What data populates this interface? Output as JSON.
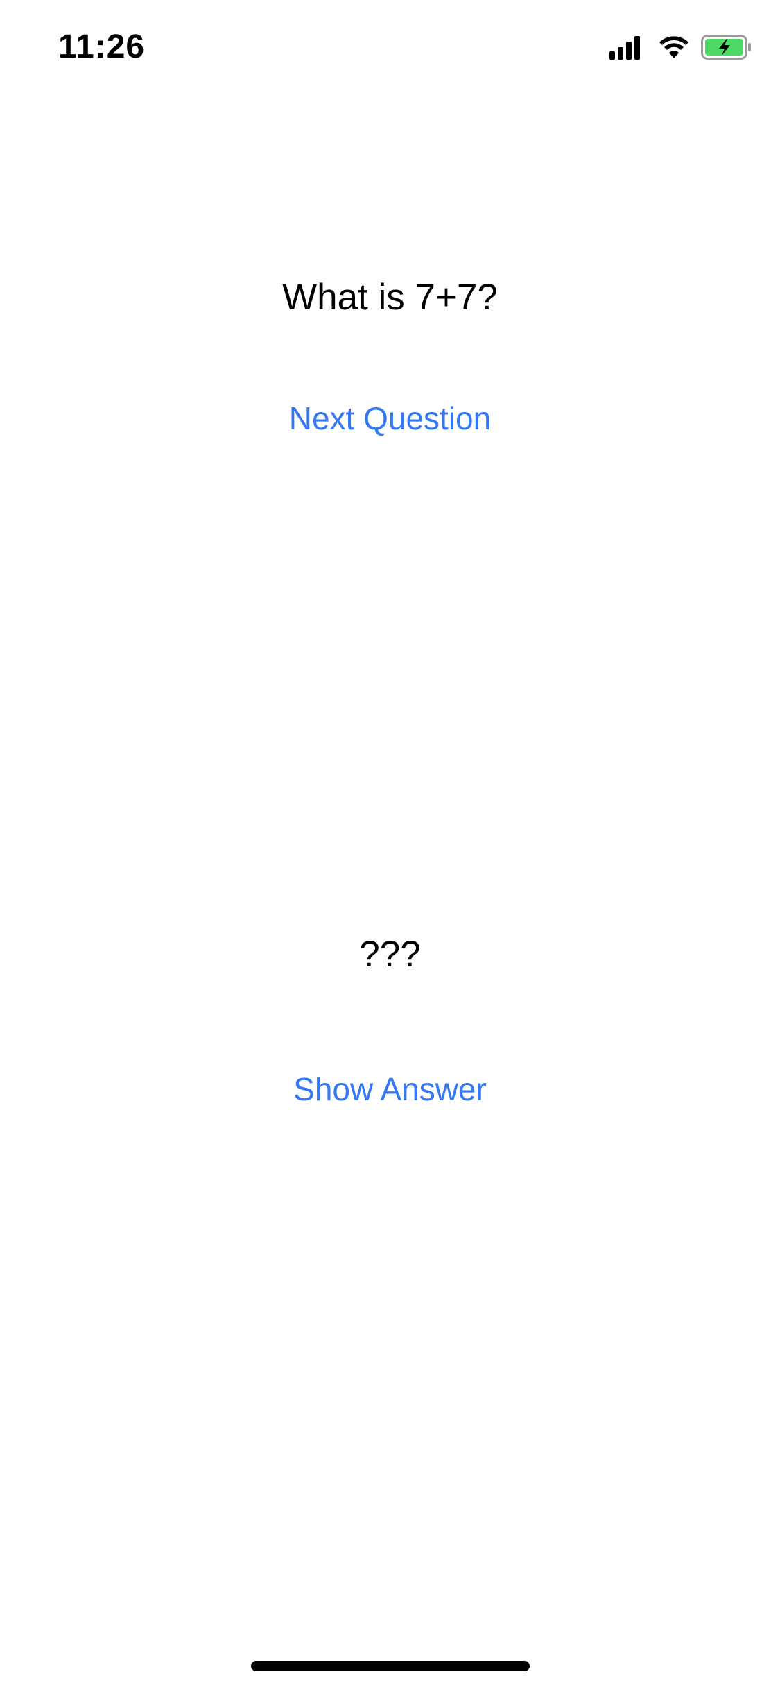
{
  "status_bar": {
    "time": "11:26",
    "icons": [
      "cellular-signal-icon",
      "wifi-icon",
      "battery-charging-icon"
    ],
    "battery_color": "#4CD964"
  },
  "main": {
    "question": "What is 7+7?",
    "next_label": "Next Question",
    "answer": "???",
    "show_label": "Show Answer"
  },
  "colors": {
    "accent": "#3478F6",
    "text": "#000000",
    "background": "#FFFFFF"
  }
}
